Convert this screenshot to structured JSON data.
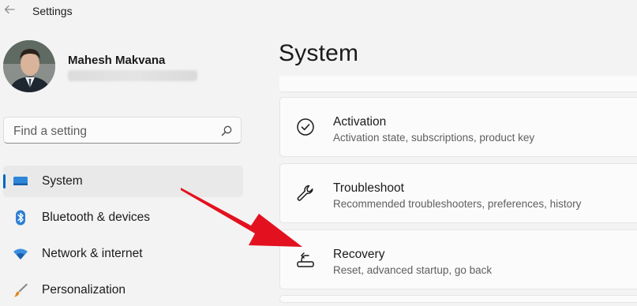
{
  "window": {
    "title": "Settings"
  },
  "user": {
    "name": "Mahesh Makvana"
  },
  "search": {
    "placeholder": "Find a setting"
  },
  "sidebar": {
    "items": [
      {
        "label": "System",
        "icon": "monitor-icon",
        "selected": true
      },
      {
        "label": "Bluetooth & devices",
        "icon": "bluetooth-icon"
      },
      {
        "label": "Network & internet",
        "icon": "wifi-icon"
      },
      {
        "label": "Personalization",
        "icon": "brush-icon"
      }
    ]
  },
  "main": {
    "title": "System",
    "cards": [
      {
        "title": "Activation",
        "desc": "Activation state, subscriptions, product key",
        "icon": "check-circle-icon"
      },
      {
        "title": "Troubleshoot",
        "desc": "Recommended troubleshooters, preferences, history",
        "icon": "wrench-icon"
      },
      {
        "title": "Recovery",
        "desc": "Reset, advanced startup, go back",
        "icon": "recovery-icon"
      }
    ]
  },
  "annotation": {
    "arrow_color": "#e3111f",
    "icon": "red-arrow-icon"
  },
  "colors": {
    "accent": "#0067c0",
    "background": "#f3f3f3",
    "card": "#fbfbfb"
  }
}
